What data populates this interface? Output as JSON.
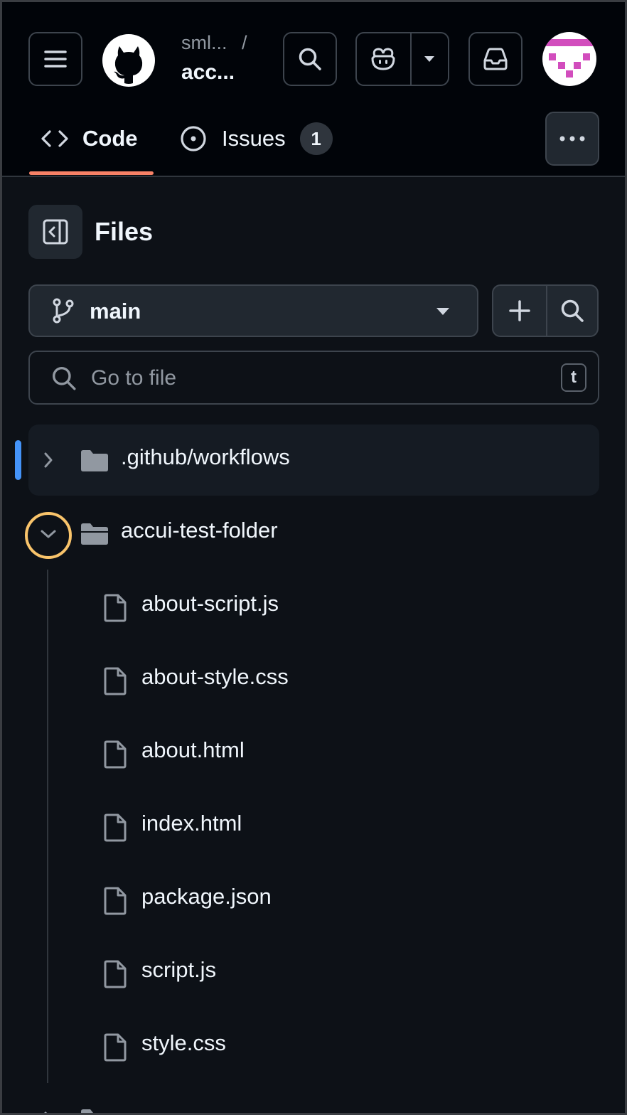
{
  "header": {
    "owner": "sml...",
    "separator": "/",
    "repo": "acc..."
  },
  "tabs": [
    {
      "label": "Code",
      "selected": true
    },
    {
      "label": "Issues",
      "count": "1"
    }
  ],
  "files_panel": {
    "title": "Files",
    "branch": "main",
    "search_placeholder": "Go to file",
    "search_shortcut": "t"
  },
  "tree": {
    "folders": [
      {
        "name": ".github/workflows",
        "expanded": false,
        "selected": true
      },
      {
        "name": "accui-test-folder",
        "expanded": true,
        "selected": false
      }
    ],
    "files": [
      {
        "name": "about-script.js"
      },
      {
        "name": "about-style.css"
      },
      {
        "name": "about.html"
      },
      {
        "name": "index.html"
      },
      {
        "name": "package.json"
      },
      {
        "name": "script.js"
      },
      {
        "name": "style.css"
      }
    ]
  },
  "colors": {
    "background": "#0d1117",
    "header_background": "#010409",
    "tab_underline": "#f78166",
    "selection_indicator": "#4493f8",
    "focus_ring": "#f9c46b",
    "avatar_accent": "#d24dbd"
  }
}
